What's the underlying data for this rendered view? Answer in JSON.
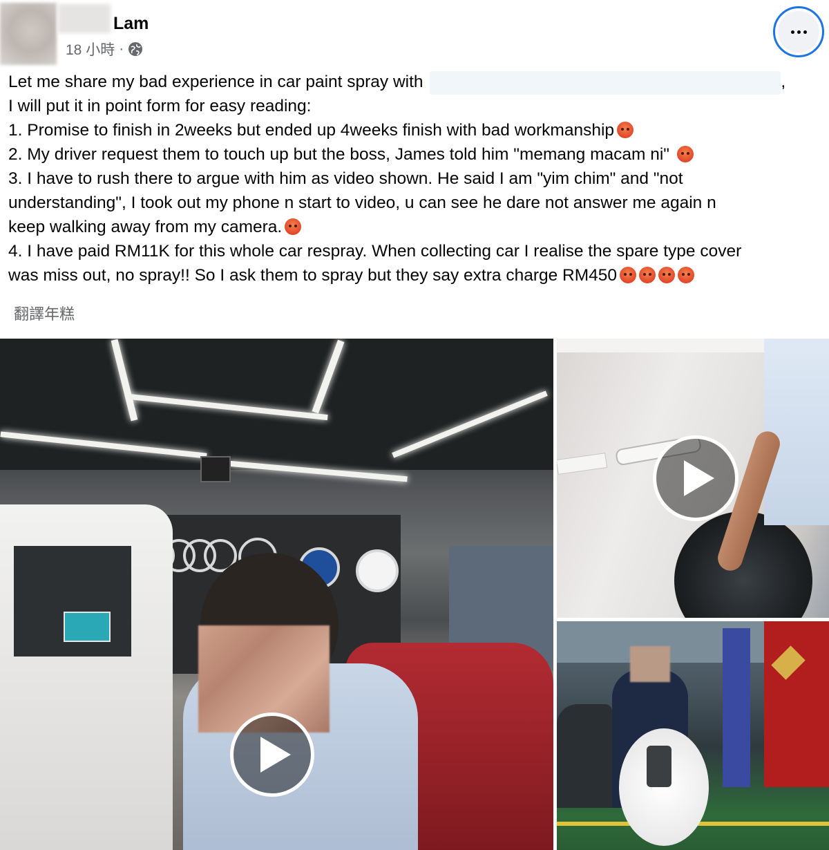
{
  "post": {
    "author": "Lam",
    "timestamp": "18 小時",
    "separator": "·",
    "privacy_icon": "globe-icon",
    "more_icon": "more-options-icon",
    "lines": [
      {
        "text": "Let me share my bad experience in car paint spray with ",
        "trail": ","
      },
      {
        "text": "I will put it in point form for easy reading:"
      },
      {
        "text": "1. Promise to finish in 2weeks but ended up 4weeks finish with bad workmanship",
        "emojis": 1
      },
      {
        "text": "2. My driver request them to touch up but the boss, James told him \"memang macam ni\" ",
        "emojis": 1
      },
      {
        "text": "3. I have to rush there to argue with him as video shown. He said I am \"yim chim\" and \"not"
      },
      {
        "text": "understanding\", I took out my phone n start to video, u can see he dare not answer me again n"
      },
      {
        "text": "keep walking away from my camera.",
        "emojis": 1
      },
      {
        "text": "4. I have paid RM11K for this whole car respray. When collecting car I realise the spare type cover"
      },
      {
        "text": "was miss out,  no spray!! So I ask them to spray but they say extra charge RM450",
        "emojis": 4
      }
    ],
    "emoji_name": "pouting-face-emoji",
    "translate_label": "翻譯年糕"
  },
  "media": {
    "items": [
      {
        "type": "video",
        "icon": "play-icon"
      },
      {
        "type": "video",
        "icon": "play-icon"
      },
      {
        "type": "image"
      }
    ]
  },
  "colors": {
    "text": "#050505",
    "secondary": "#65676b",
    "focus_ring": "#1b74e4"
  }
}
